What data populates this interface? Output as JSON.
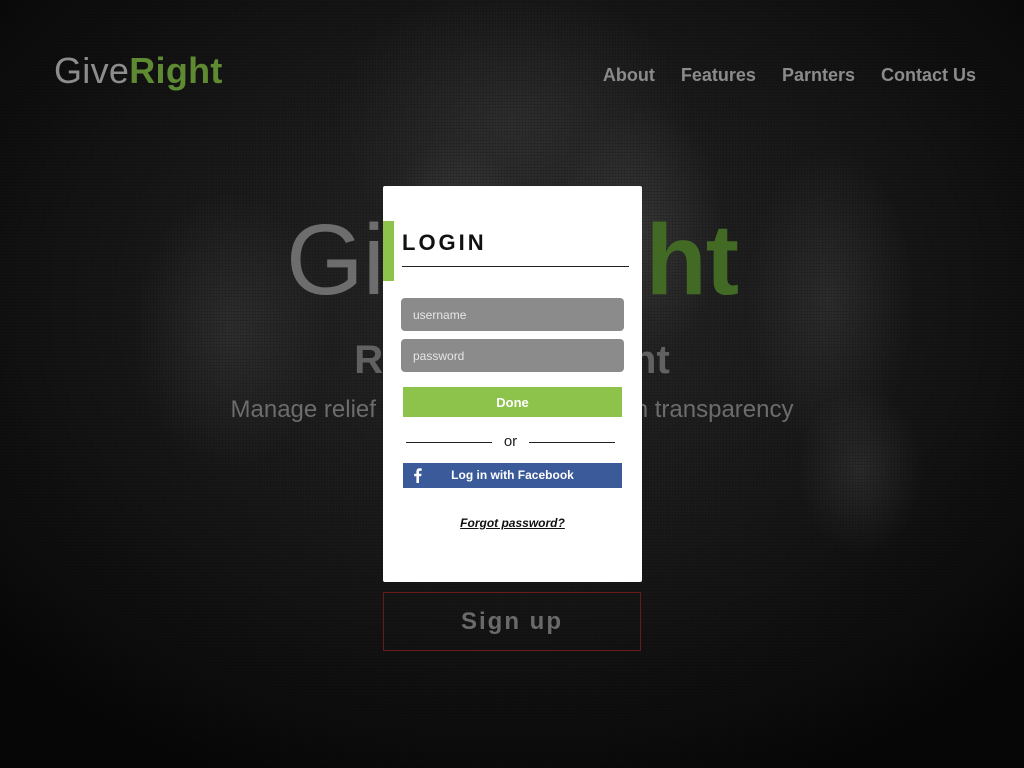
{
  "brand": {
    "part1": "Give",
    "part2": "Right"
  },
  "nav": {
    "items": [
      {
        "label": "About"
      },
      {
        "label": "Features"
      },
      {
        "label": "Parnters"
      },
      {
        "label": "Contact Us"
      }
    ]
  },
  "hero": {
    "title_part1": "Give",
    "title_part2": "Right",
    "tagline": "Relief done right",
    "subtitle": "Manage relief operations and work with transparency"
  },
  "signup": {
    "label": "Sign up"
  },
  "login": {
    "title": "LOGIN",
    "username_placeholder": "username",
    "password_placeholder": "password",
    "done_label": "Done",
    "or_text": "or",
    "facebook_label": "Log in with Facebook",
    "forgot_label": "Forgot password?"
  },
  "colors": {
    "accent_green": "#8dc34a",
    "brand_green": "#5e8a32",
    "facebook_blue": "#3b5a9a",
    "signup_border": "#6a1a1a"
  },
  "icons": {
    "facebook": "facebook-icon"
  }
}
